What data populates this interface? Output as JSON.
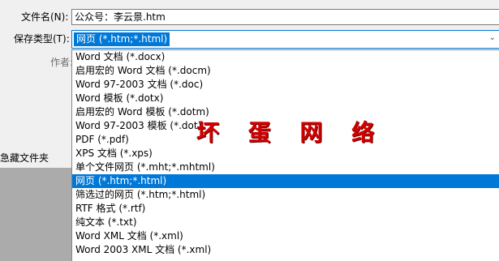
{
  "filename": {
    "label": "文件名(N):",
    "value": "公众号：李云景.htm"
  },
  "savetype": {
    "label": "保存类型(T):",
    "value": "网页 (*.htm;*.html)"
  },
  "author": {
    "label": "作者:"
  },
  "sidebar": {
    "hide_folders": "急藏文件夹"
  },
  "dropdown": {
    "options": [
      "Word 文档 (*.docx)",
      "启用宏的 Word 文档 (*.docm)",
      "Word 97-2003 文档 (*.doc)",
      "Word 模板 (*.dotx)",
      "启用宏的 Word 模板 (*.dotm)",
      "Word 97-2003 模板 (*.dot)",
      "PDF (*.pdf)",
      "XPS 文档 (*.xps)",
      "单个文件网页 (*.mht;*.mhtml)",
      "网页 (*.htm;*.html)",
      "筛选过的网页 (*.htm;*.html)",
      "RTF 格式 (*.rtf)",
      "纯文本 (*.txt)",
      "Word XML 文档 (*.xml)",
      "Word 2003 XML 文档 (*.xml)"
    ],
    "selected_index": 9
  },
  "watermark": "坏 蛋 网 络",
  "colors": {
    "accent": "#0078d7",
    "watermark": "#d40000"
  }
}
